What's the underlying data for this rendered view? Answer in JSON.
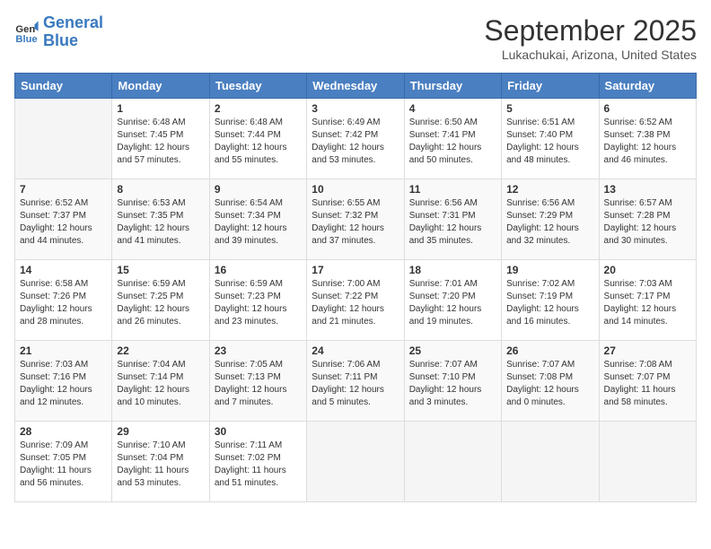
{
  "header": {
    "logo_line1": "General",
    "logo_line2": "Blue",
    "month": "September 2025",
    "location": "Lukachukai, Arizona, United States"
  },
  "days_of_week": [
    "Sunday",
    "Monday",
    "Tuesday",
    "Wednesday",
    "Thursday",
    "Friday",
    "Saturday"
  ],
  "weeks": [
    [
      {
        "day": "",
        "sunrise": "",
        "sunset": "",
        "daylight": ""
      },
      {
        "day": "1",
        "sunrise": "Sunrise: 6:48 AM",
        "sunset": "Sunset: 7:45 PM",
        "daylight": "Daylight: 12 hours and 57 minutes."
      },
      {
        "day": "2",
        "sunrise": "Sunrise: 6:48 AM",
        "sunset": "Sunset: 7:44 PM",
        "daylight": "Daylight: 12 hours and 55 minutes."
      },
      {
        "day": "3",
        "sunrise": "Sunrise: 6:49 AM",
        "sunset": "Sunset: 7:42 PM",
        "daylight": "Daylight: 12 hours and 53 minutes."
      },
      {
        "day": "4",
        "sunrise": "Sunrise: 6:50 AM",
        "sunset": "Sunset: 7:41 PM",
        "daylight": "Daylight: 12 hours and 50 minutes."
      },
      {
        "day": "5",
        "sunrise": "Sunrise: 6:51 AM",
        "sunset": "Sunset: 7:40 PM",
        "daylight": "Daylight: 12 hours and 48 minutes."
      },
      {
        "day": "6",
        "sunrise": "Sunrise: 6:52 AM",
        "sunset": "Sunset: 7:38 PM",
        "daylight": "Daylight: 12 hours and 46 minutes."
      }
    ],
    [
      {
        "day": "7",
        "sunrise": "Sunrise: 6:52 AM",
        "sunset": "Sunset: 7:37 PM",
        "daylight": "Daylight: 12 hours and 44 minutes."
      },
      {
        "day": "8",
        "sunrise": "Sunrise: 6:53 AM",
        "sunset": "Sunset: 7:35 PM",
        "daylight": "Daylight: 12 hours and 41 minutes."
      },
      {
        "day": "9",
        "sunrise": "Sunrise: 6:54 AM",
        "sunset": "Sunset: 7:34 PM",
        "daylight": "Daylight: 12 hours and 39 minutes."
      },
      {
        "day": "10",
        "sunrise": "Sunrise: 6:55 AM",
        "sunset": "Sunset: 7:32 PM",
        "daylight": "Daylight: 12 hours and 37 minutes."
      },
      {
        "day": "11",
        "sunrise": "Sunrise: 6:56 AM",
        "sunset": "Sunset: 7:31 PM",
        "daylight": "Daylight: 12 hours and 35 minutes."
      },
      {
        "day": "12",
        "sunrise": "Sunrise: 6:56 AM",
        "sunset": "Sunset: 7:29 PM",
        "daylight": "Daylight: 12 hours and 32 minutes."
      },
      {
        "day": "13",
        "sunrise": "Sunrise: 6:57 AM",
        "sunset": "Sunset: 7:28 PM",
        "daylight": "Daylight: 12 hours and 30 minutes."
      }
    ],
    [
      {
        "day": "14",
        "sunrise": "Sunrise: 6:58 AM",
        "sunset": "Sunset: 7:26 PM",
        "daylight": "Daylight: 12 hours and 28 minutes."
      },
      {
        "day": "15",
        "sunrise": "Sunrise: 6:59 AM",
        "sunset": "Sunset: 7:25 PM",
        "daylight": "Daylight: 12 hours and 26 minutes."
      },
      {
        "day": "16",
        "sunrise": "Sunrise: 6:59 AM",
        "sunset": "Sunset: 7:23 PM",
        "daylight": "Daylight: 12 hours and 23 minutes."
      },
      {
        "day": "17",
        "sunrise": "Sunrise: 7:00 AM",
        "sunset": "Sunset: 7:22 PM",
        "daylight": "Daylight: 12 hours and 21 minutes."
      },
      {
        "day": "18",
        "sunrise": "Sunrise: 7:01 AM",
        "sunset": "Sunset: 7:20 PM",
        "daylight": "Daylight: 12 hours and 19 minutes."
      },
      {
        "day": "19",
        "sunrise": "Sunrise: 7:02 AM",
        "sunset": "Sunset: 7:19 PM",
        "daylight": "Daylight: 12 hours and 16 minutes."
      },
      {
        "day": "20",
        "sunrise": "Sunrise: 7:03 AM",
        "sunset": "Sunset: 7:17 PM",
        "daylight": "Daylight: 12 hours and 14 minutes."
      }
    ],
    [
      {
        "day": "21",
        "sunrise": "Sunrise: 7:03 AM",
        "sunset": "Sunset: 7:16 PM",
        "daylight": "Daylight: 12 hours and 12 minutes."
      },
      {
        "day": "22",
        "sunrise": "Sunrise: 7:04 AM",
        "sunset": "Sunset: 7:14 PM",
        "daylight": "Daylight: 12 hours and 10 minutes."
      },
      {
        "day": "23",
        "sunrise": "Sunrise: 7:05 AM",
        "sunset": "Sunset: 7:13 PM",
        "daylight": "Daylight: 12 hours and 7 minutes."
      },
      {
        "day": "24",
        "sunrise": "Sunrise: 7:06 AM",
        "sunset": "Sunset: 7:11 PM",
        "daylight": "Daylight: 12 hours and 5 minutes."
      },
      {
        "day": "25",
        "sunrise": "Sunrise: 7:07 AM",
        "sunset": "Sunset: 7:10 PM",
        "daylight": "Daylight: 12 hours and 3 minutes."
      },
      {
        "day": "26",
        "sunrise": "Sunrise: 7:07 AM",
        "sunset": "Sunset: 7:08 PM",
        "daylight": "Daylight: 12 hours and 0 minutes."
      },
      {
        "day": "27",
        "sunrise": "Sunrise: 7:08 AM",
        "sunset": "Sunset: 7:07 PM",
        "daylight": "Daylight: 11 hours and 58 minutes."
      }
    ],
    [
      {
        "day": "28",
        "sunrise": "Sunrise: 7:09 AM",
        "sunset": "Sunset: 7:05 PM",
        "daylight": "Daylight: 11 hours and 56 minutes."
      },
      {
        "day": "29",
        "sunrise": "Sunrise: 7:10 AM",
        "sunset": "Sunset: 7:04 PM",
        "daylight": "Daylight: 11 hours and 53 minutes."
      },
      {
        "day": "30",
        "sunrise": "Sunrise: 7:11 AM",
        "sunset": "Sunset: 7:02 PM",
        "daylight": "Daylight: 11 hours and 51 minutes."
      },
      {
        "day": "",
        "sunrise": "",
        "sunset": "",
        "daylight": ""
      },
      {
        "day": "",
        "sunrise": "",
        "sunset": "",
        "daylight": ""
      },
      {
        "day": "",
        "sunrise": "",
        "sunset": "",
        "daylight": ""
      },
      {
        "day": "",
        "sunrise": "",
        "sunset": "",
        "daylight": ""
      }
    ]
  ]
}
